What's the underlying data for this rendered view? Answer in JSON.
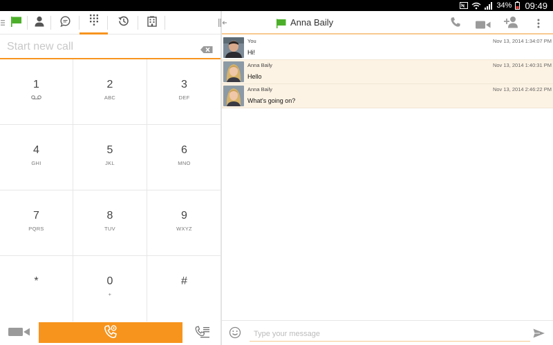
{
  "status_bar": {
    "battery": "34%",
    "time": "09:49"
  },
  "left_pane": {
    "tabs": [
      {
        "name": "presence",
        "icon": "flag-icon"
      },
      {
        "name": "contacts",
        "icon": "person-icon"
      },
      {
        "name": "chat",
        "icon": "chat-bubble-icon"
      },
      {
        "name": "dialpad",
        "icon": "dialpad-icon",
        "active": true
      },
      {
        "name": "history",
        "icon": "history-icon"
      },
      {
        "name": "directory",
        "icon": "building-icon"
      }
    ],
    "search": {
      "placeholder": "Start new call",
      "value": ""
    },
    "keys": [
      {
        "digit": "1",
        "letters": ""
      },
      {
        "digit": "2",
        "letters": "ABC"
      },
      {
        "digit": "3",
        "letters": "DEF"
      },
      {
        "digit": "4",
        "letters": "GHI"
      },
      {
        "digit": "5",
        "letters": "JKL"
      },
      {
        "digit": "6",
        "letters": "MNO"
      },
      {
        "digit": "7",
        "letters": "PQRS"
      },
      {
        "digit": "8",
        "letters": "TUV"
      },
      {
        "digit": "9",
        "letters": "WXYZ"
      },
      {
        "digit": "*",
        "letters": ""
      },
      {
        "digit": "0",
        "letters": "+"
      },
      {
        "digit": "#",
        "letters": ""
      }
    ]
  },
  "conversation": {
    "contact_name": "Anna Baily",
    "messages": [
      {
        "sender": "You",
        "time": "Nov 13, 2014 1:34:07 PM",
        "text": "Hi!",
        "from_self": true
      },
      {
        "sender": "Anna Baily",
        "time": "Nov 13, 2014 1:40:31 PM",
        "text": "Hello",
        "from_self": false
      },
      {
        "sender": "Anna Baily",
        "time": "Nov 13, 2014 2:46:22 PM",
        "text": "What's going on?",
        "from_self": false
      }
    ],
    "composer": {
      "placeholder": "Type your message",
      "value": ""
    }
  },
  "colors": {
    "accent": "#f7941d",
    "presence_green": "#4caf2a",
    "incoming_bg": "#fdf3e4"
  }
}
